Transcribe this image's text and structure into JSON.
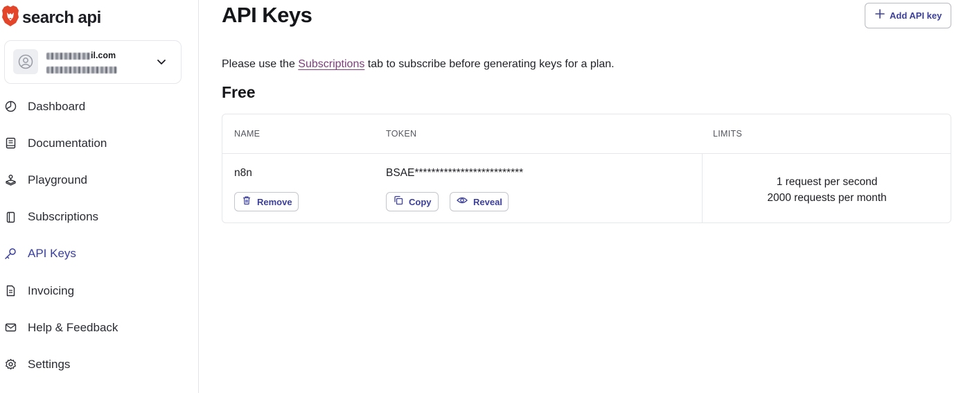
{
  "brand": {
    "name": "search api",
    "icon": "brave-lion-icon",
    "color": "#e2452a"
  },
  "account": {
    "email_suffix": "il.com",
    "chevron_icon": "chevron-down-icon"
  },
  "sidebar": {
    "items": [
      {
        "label": "Dashboard",
        "icon": "dashboard-icon",
        "active": false
      },
      {
        "label": "Documentation",
        "icon": "book-icon",
        "active": false
      },
      {
        "label": "Playground",
        "icon": "joystick-icon",
        "active": false
      },
      {
        "label": "Subscriptions",
        "icon": "subscriptions-icon",
        "active": false
      },
      {
        "label": "API Keys",
        "icon": "key-icon",
        "active": true
      },
      {
        "label": "Invoicing",
        "icon": "invoice-icon",
        "active": false
      },
      {
        "label": "Help & Feedback",
        "icon": "mail-icon",
        "active": false
      },
      {
        "label": "Settings",
        "icon": "gear-icon",
        "active": false
      }
    ]
  },
  "header": {
    "title": "API Keys",
    "add_button": "Add API key"
  },
  "notice": {
    "before": "Please use the ",
    "link": "Subscriptions",
    "after": " tab to subscribe before generating keys for a plan."
  },
  "plan": {
    "title": "Free",
    "columns": [
      "NAME",
      "TOKEN",
      "LIMITS"
    ],
    "key": {
      "name": "n8n",
      "token": "BSAE**************************",
      "limits": [
        "1 request per second",
        "2000 requests per month"
      ],
      "remove_label": "Remove",
      "copy_label": "Copy",
      "reveal_label": "Reveal"
    }
  },
  "colors": {
    "accent": "#3b3f9a",
    "link": "#7b3f7a",
    "border": "#e6e7eb"
  }
}
